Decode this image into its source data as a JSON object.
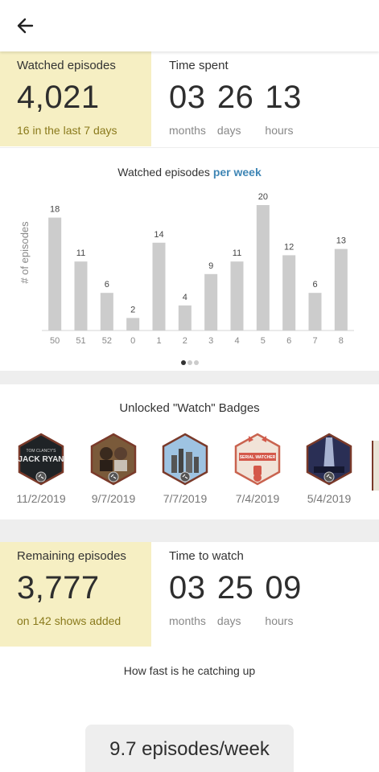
{
  "watched": {
    "label": "Watched episodes",
    "count": "4,021",
    "recent": "16 in the last 7 days"
  },
  "time_spent": {
    "label": "Time spent",
    "months": "03",
    "days": "26",
    "hours": "13",
    "months_label": "months",
    "days_label": "days",
    "hours_label": "hours"
  },
  "chart_section": {
    "title_prefix": "Watched episodes",
    "title_accent": "per week",
    "accent_color": "#3f86b5"
  },
  "chart_data": {
    "type": "bar",
    "title": "Watched episodes per week",
    "xlabel": "",
    "ylabel": "# of episodes",
    "categories": [
      "50",
      "51",
      "52",
      "0",
      "1",
      "2",
      "3",
      "4",
      "5",
      "6",
      "7",
      "8"
    ],
    "values": [
      18,
      11,
      6,
      2,
      14,
      4,
      9,
      11,
      20,
      12,
      6,
      13
    ],
    "ylim": [
      0,
      20
    ],
    "bar_color": "#cccccc",
    "grid": false,
    "page_indicator": {
      "pages": 3,
      "active": 1
    }
  },
  "badges": {
    "title": "Unlocked \"Watch\" Badges",
    "items": [
      {
        "date": "11/2/2019",
        "icon": "jack-ryan-badge-icon",
        "text_top": "TOM CLANCY'S",
        "text_main": "JACK RYAN"
      },
      {
        "date": "9/7/2019",
        "icon": "show-cast-badge-icon"
      },
      {
        "date": "7/7/2019",
        "icon": "city-skyline-badge-icon"
      },
      {
        "date": "7/4/2019",
        "icon": "serial-watcher-badge-icon",
        "text_main": "SERIAL WATCHER"
      },
      {
        "date": "5/4/2019",
        "icon": "light-beam-badge-icon"
      }
    ]
  },
  "remaining": {
    "label": "Remaining episodes",
    "count": "3,777",
    "shows": "on 142 shows added"
  },
  "time_to_watch": {
    "label": "Time to watch",
    "months": "03",
    "days": "25",
    "hours": "09",
    "months_label": "months",
    "days_label": "days",
    "hours_label": "hours"
  },
  "speed": {
    "title": "How fast is he catching up",
    "value": "9.7 episodes/week"
  },
  "colors": {
    "yellow_panel": "#f6efc3",
    "yellow_text": "#8a7a1c",
    "badge_border": "#7a3a2a"
  }
}
